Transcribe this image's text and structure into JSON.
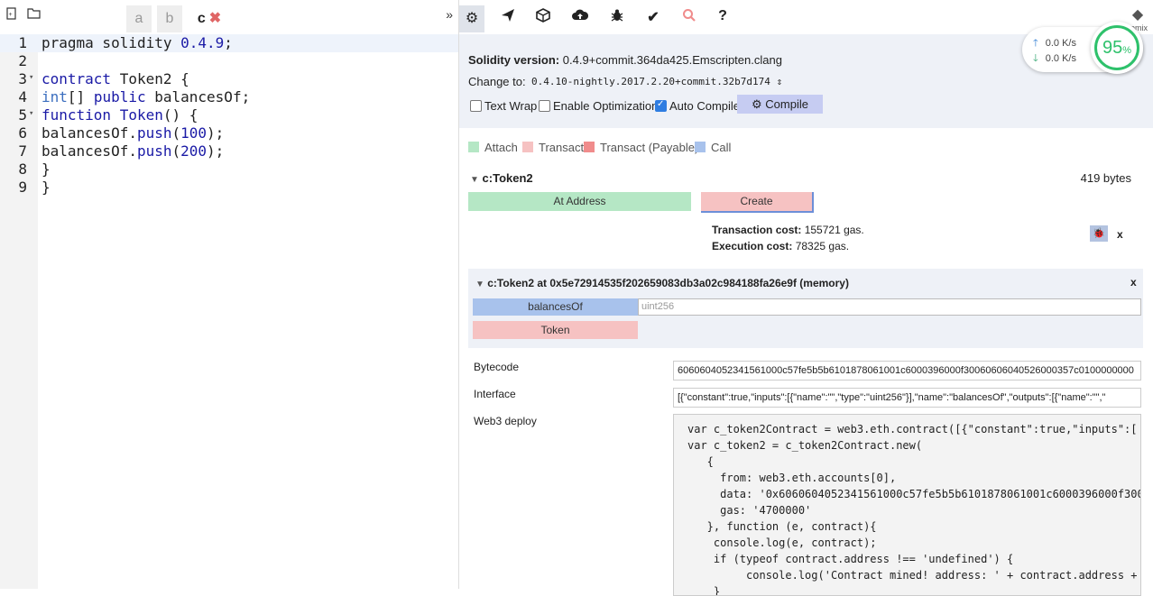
{
  "editor": {
    "tabs": [
      {
        "label": "a"
      },
      {
        "label": "b"
      },
      {
        "label": "c",
        "close": "✖"
      }
    ],
    "collapse_glyph": "»",
    "lines": [
      {
        "n": "1",
        "text": "pragma solidity 0.4.9;"
      },
      {
        "n": "2",
        "text": ""
      },
      {
        "n": "3",
        "text": "contract Token2 {"
      },
      {
        "n": "4",
        "text": "int[] public balancesOf;"
      },
      {
        "n": "5",
        "text": "function Token() {"
      },
      {
        "n": "6",
        "text": "balancesOf.push(100);"
      },
      {
        "n": "7",
        "text": "balancesOf.push(200);"
      },
      {
        "n": "8",
        "text": "}"
      },
      {
        "n": "9",
        "text": "}"
      }
    ]
  },
  "toolbar": {
    "icons": [
      "gear-icon",
      "send-icon",
      "cube-icon",
      "cloud-upload-icon",
      "bug-icon",
      "check-icon",
      "search-icon",
      "help-icon"
    ],
    "help_glyph": "?",
    "remix_label": "remix"
  },
  "compile": {
    "version_label": "Solidity version:",
    "version_value": "0.4.9+commit.364da425.Emscripten.clang",
    "change_label": "Change to:",
    "change_value": "0.4.10-nightly.2017.2.20+commit.32b7d174",
    "text_wrap": "Text Wrap",
    "enable_opt": "Enable Optimization",
    "auto_compile": "Auto Compile",
    "compile_button": "Compile"
  },
  "network": {
    "up": "0.0 K/s",
    "down": "0.0 K/s",
    "gauge_value": "95",
    "gauge_unit": "%"
  },
  "legend": {
    "attach": "Attach",
    "transact": "Transact",
    "transact_payable": "Transact (Payable)",
    "call": "Call",
    "colors": {
      "attach": "#b5e7c5",
      "transact": "#f6c2c2",
      "payable": "#f08c8c",
      "call": "#a8c2ec"
    }
  },
  "contract": {
    "name": "c:Token2",
    "size": "419 bytes",
    "at_address": "At Address",
    "create": "Create",
    "tx_cost_label": "Transaction cost:",
    "tx_cost_value": "155721 gas.",
    "exec_cost_label": "Execution cost:",
    "exec_cost_value": "78325 gas.",
    "close": "x"
  },
  "instance": {
    "title": "c:Token2 at 0x5e72914535f202659083db3a02c984188fa26e9f (memory)",
    "close": "x",
    "balances_button": "balancesOf",
    "balances_placeholder": "uint256",
    "token_button": "Token"
  },
  "details": {
    "bytecode_label": "Bytecode",
    "bytecode_value": "6060604052341561000c57fe5b5b6101878061001c6000396000f30060606040526000357c0100000000",
    "interface_label": "Interface",
    "interface_value": "[{\"constant\":true,\"inputs\":[{\"name\":\"\",\"type\":\"uint256\"}],\"name\":\"balancesOf\",\"outputs\":[{\"name\":\"\",\"",
    "web3_label": "Web3 deploy",
    "web3_lines": [
      "var c_token2Contract = web3.eth.contract([{\"constant\":true,\"inputs\":[",
      "var c_token2 = c_token2Contract.new(",
      "   {",
      "     from: web3.eth.accounts[0],",
      "     data: '0x6060604052341561000c57fe5b5b6101878061001c6000396000f300",
      "     gas: '4700000'",
      "   }, function (e, contract){",
      "    console.log(e, contract);",
      "    if (typeof contract.address !== 'undefined') {",
      "         console.log('Contract mined! address: ' + contract.address +",
      "    }"
    ]
  }
}
